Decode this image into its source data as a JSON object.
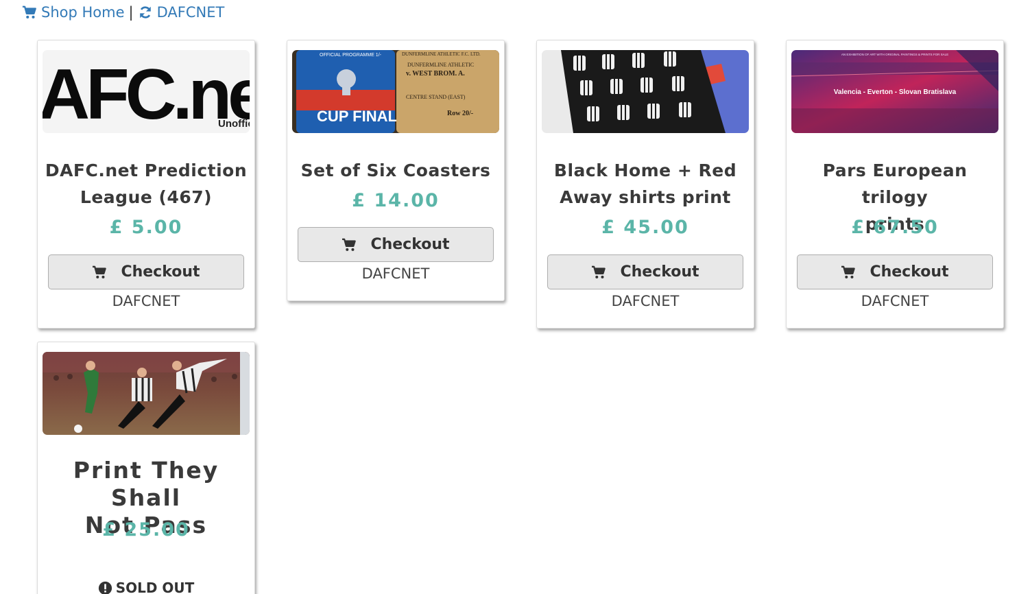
{
  "breadcrumb": {
    "shop_home": "Shop Home",
    "separator": "|",
    "dafcnet": "DAFCNET"
  },
  "colors": {
    "link": "#337ab7",
    "price": "#5bb5a8",
    "button_bg": "#e8e8e8"
  },
  "products": [
    {
      "title_line1": "DAFC.net Prediction",
      "title_line2": "League (467)",
      "price": "£ 5.00",
      "checkout_label": "Checkout",
      "seller": "DAFCNET",
      "image_text": "AFC.ne",
      "image_subtext": "Unoffic"
    },
    {
      "title_line1": "Set of Six Coasters",
      "price": "£ 14.00",
      "checkout_label": "Checkout",
      "seller": "DAFCNET",
      "image_text_1": "OFFICIAL PROGRAMME 1/-",
      "image_text_2": "CUP FINAL",
      "image_text_3": "DUNFERMLINE ATHLETIC",
      "image_text_4": "v. WEST BROM. A.",
      "image_text_5": "CENTRE STAND (EAST)",
      "image_text_6": "Row 20/-"
    },
    {
      "title_line1": "Black Home + Red",
      "title_line2": "Away shirts print",
      "price": "£ 45.00",
      "checkout_label": "Checkout",
      "seller": "DAFCNET"
    },
    {
      "title_line1": "Pars European trilogy",
      "title_line2": "prints",
      "price": "£ 67.50",
      "checkout_label": "Checkout",
      "seller": "DAFCNET",
      "image_text": "Valencia - Everton - Slovan Bratislava",
      "image_header": "AN EXHIBITION OF ART WITH ORIGINAL PAINTINGS & PRINTS FOR SALE"
    },
    {
      "title_line1": "Print They Shall",
      "title_line2": "Not Pass",
      "price": "£ 25.00",
      "soldout_label": "SOLD OUT"
    }
  ]
}
